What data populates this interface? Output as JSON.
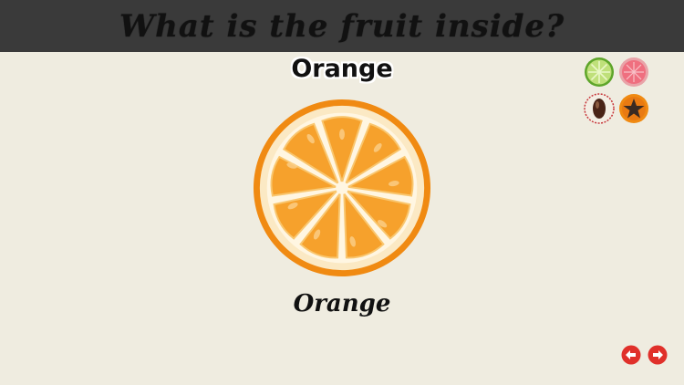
{
  "header": {
    "title": "What is the fruit inside?"
  },
  "fruit": {
    "title": "Orange",
    "caption": "Orange",
    "image_icon": "orange-slice-icon"
  },
  "choices": [
    {
      "icon": "lime-icon"
    },
    {
      "icon": "watermelon-icon"
    },
    {
      "icon": "seed-icon"
    },
    {
      "icon": "star-fruit-icon"
    }
  ],
  "navigation": {
    "previous_icon": "arrow-left-icon",
    "next_icon": "arrow-right-icon"
  },
  "colors": {
    "background": "#efece0",
    "header_bar": "#3a3a3a",
    "orange": "#f29a1a",
    "nav_red": "#e0302a"
  }
}
